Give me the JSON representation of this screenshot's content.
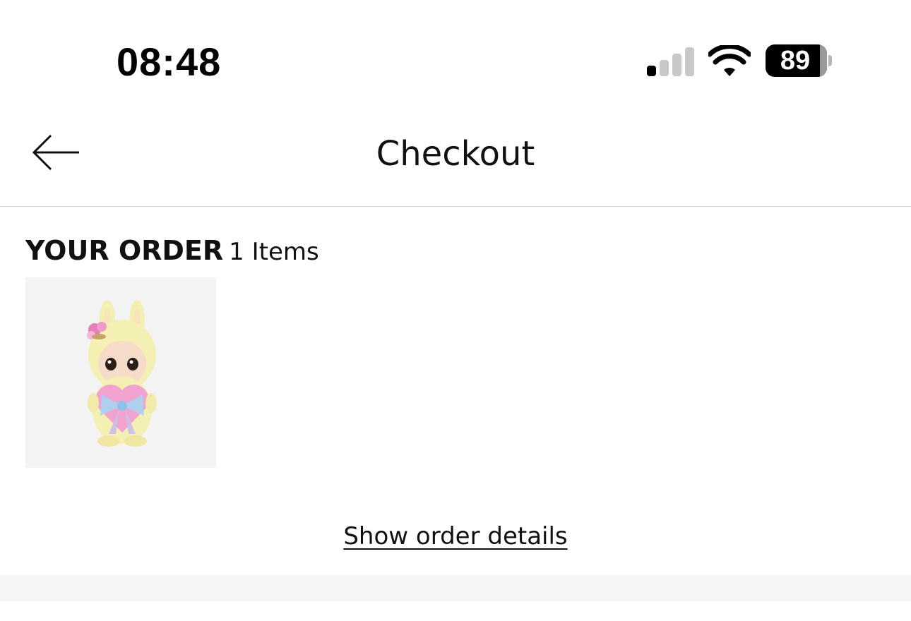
{
  "status_bar": {
    "time": "08:48",
    "battery_level": "89",
    "battery_percent": 89,
    "signal_bars_active": 1,
    "signal_bars_total": 4,
    "icons": [
      "cellular-signal-icon",
      "wifi-icon",
      "battery-icon"
    ]
  },
  "header": {
    "title": "Checkout",
    "back_icon": "arrow-left-icon"
  },
  "order": {
    "title": "YOUR ORDER",
    "count_label": "1 Items",
    "items": [
      {
        "image_description_icon": "plush-figure-toy",
        "background": "#f3f3f3"
      }
    ],
    "details_link": "Show order details"
  },
  "colors": {
    "text": "#111111",
    "divider": "#d6d6d6",
    "band": "#f5f5f5"
  }
}
